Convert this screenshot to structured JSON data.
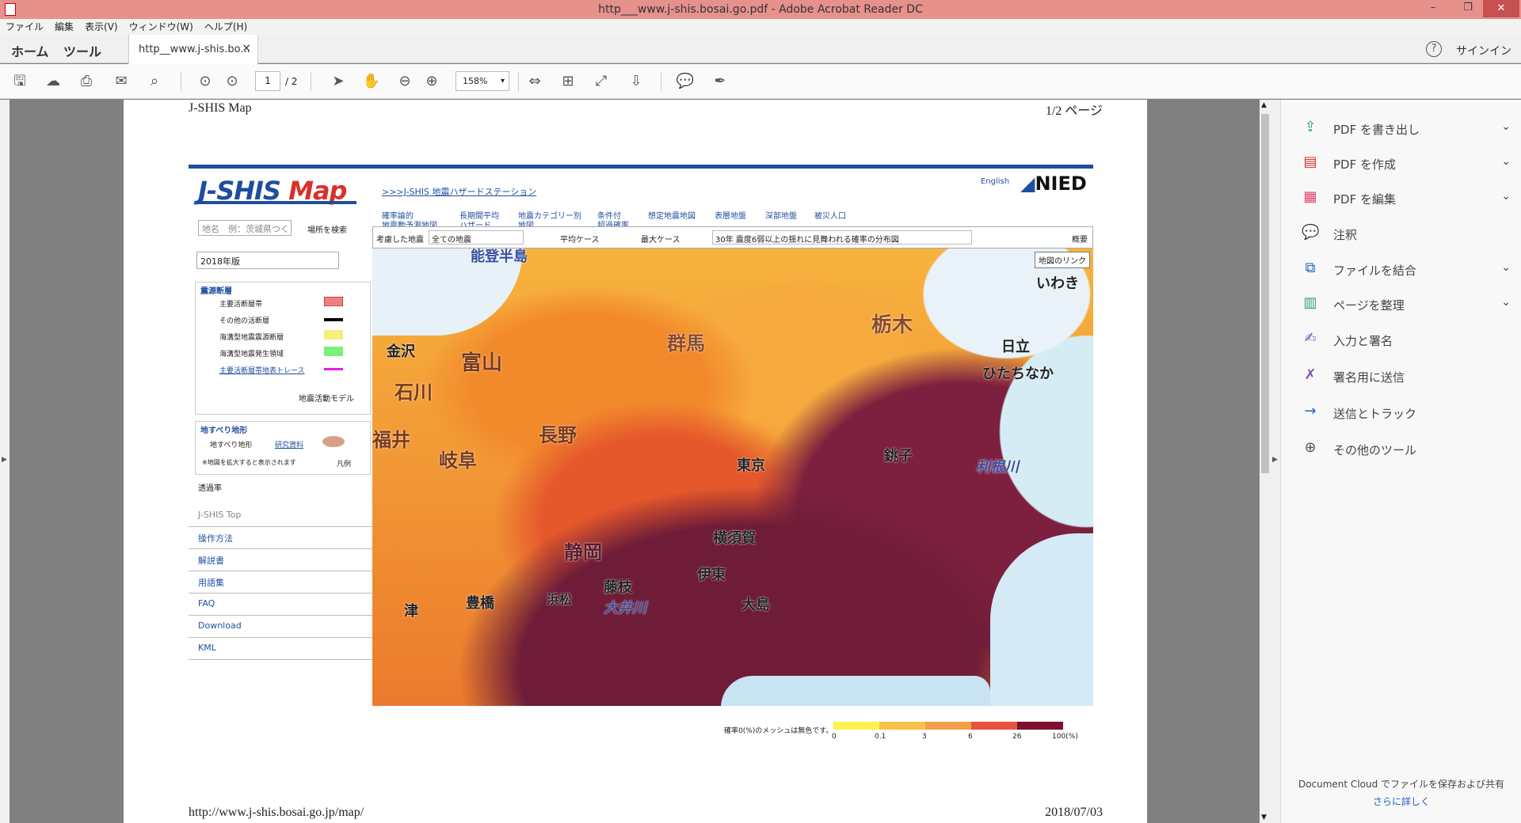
{
  "window": {
    "title": "http___www.j-shis.bosai.go.pdf - Adobe Acrobat Reader DC"
  },
  "menu": [
    "ファイル",
    "編集",
    "表示(V)",
    "ウィンドウ(W)",
    "ヘルプ(H)"
  ],
  "tabs": {
    "home": "ホーム",
    "tools": "ツール",
    "doc": "http__www.j-shis.bo...",
    "close": "×"
  },
  "signin": "サインイン",
  "toolbar": {
    "page_current": "1",
    "page_total": "/ 2",
    "zoom": "158%"
  },
  "right_panel": {
    "items": [
      {
        "label": "PDF を書き出し",
        "icon": "export-pdf-icon",
        "color": "#2aa163",
        "chevron": "⌄"
      },
      {
        "label": "PDF を作成",
        "icon": "create-pdf-icon",
        "color": "#d9302b",
        "chevron": "⌄"
      },
      {
        "label": "PDF を編集",
        "icon": "edit-pdf-icon",
        "color": "#e0406a",
        "chevron": "⌄"
      },
      {
        "label": "注釈",
        "icon": "comment-icon",
        "color": "#f2b700",
        "chevron": ""
      },
      {
        "label": "ファイルを結合",
        "icon": "combine-icon",
        "color": "#1a62c4",
        "chevron": "⌄"
      },
      {
        "label": "ページを整理",
        "icon": "organize-icon",
        "color": "#2aa163",
        "chevron": "⌄"
      },
      {
        "label": "入力と署名",
        "icon": "fill-sign-icon",
        "color": "#7b4fb5",
        "chevron": ""
      },
      {
        "label": "署名用に送信",
        "icon": "send-sign-icon",
        "color": "#7b4fb5",
        "chevron": ""
      },
      {
        "label": "送信とトラック",
        "icon": "send-track-icon",
        "color": "#1a62c4",
        "chevron": ""
      },
      {
        "label": "その他のツール",
        "icon": "more-tools-icon",
        "color": "#555555",
        "chevron": ""
      }
    ],
    "cloud_text": "Document Cloud でファイルを保存および共有",
    "cloud_link": "さらに詳しく"
  },
  "pdf": {
    "header_left": "J-SHIS Map",
    "header_right": "1/2 ページ",
    "footer_left": "http://www.j-shis.bosai.go.jp/map/",
    "footer_right": "2018/07/03",
    "site": {
      "logo_j": "J-SHIS",
      "logo_map": "Map",
      "station_link": ">>>J-SHIS 地震ハザードステーション",
      "english": "English",
      "nied": "NIED",
      "nav": [
        "確率論的\n地震動予測地図",
        "長期間平均\nハザード",
        "地震カテゴリー別\n地図",
        "条件付\n超過確率",
        "想定地震地図",
        "表層地盤",
        "深部地盤",
        "被災人口"
      ],
      "search_placeholder": "地名　例：茨城県つく",
      "search_btn": "場所を検索",
      "edition": "2018年版",
      "legend_title": "震源断層",
      "legend_rows": [
        {
          "label": "主要活断層帯",
          "color": "#f08080"
        },
        {
          "label": "その他の活断層",
          "color": "#000000"
        },
        {
          "label": "海溝型地震震源断層",
          "color": "#f5f07a"
        },
        {
          "label": "海溝型地震発生領域",
          "color": "#7cf07a"
        },
        {
          "label": "主要活断層帯地表トレース",
          "color": "#e020e0"
        }
      ],
      "legend_model": "地震活動モデル",
      "landslide_title": "地すべり地形",
      "landslide_label": "地すべり地形",
      "landslide_link": "研究資料",
      "landslide_note": "※地図を拡大すると表示されます",
      "legend_toggle": "凡例",
      "transparency": "透過率",
      "sidenav": [
        "J-SHIS Top",
        "操作方法",
        "解説書",
        "用語集",
        "FAQ",
        "Download",
        "KML"
      ],
      "mapbar": {
        "considered": "考慮した地震",
        "all_quakes": "全ての地震",
        "avg": "平均ケース",
        "max": "最大ケース",
        "desc": "30年 震度6弱以上の揺れに見舞われる確率の分布図",
        "outline": "概要"
      },
      "map_link": "地図のリンク",
      "cities": [
        "能登半島",
        "いわき",
        "金沢",
        "富山",
        "群馬",
        "栃木",
        "日立",
        "ひたちなか",
        "石川",
        "福井",
        "岐阜",
        "長野",
        "東京",
        "銚子",
        "利根川",
        "静岡",
        "藤枝",
        "横須賀",
        "伊東",
        "大島",
        "大井川",
        "豊橋",
        "津",
        "浜松"
      ],
      "colorbar_note": "確率0(%)のメッシュは無色です。",
      "colorbar_ticks": [
        "0",
        "0.1",
        "3",
        "6",
        "26",
        "100(%)"
      ]
    }
  }
}
